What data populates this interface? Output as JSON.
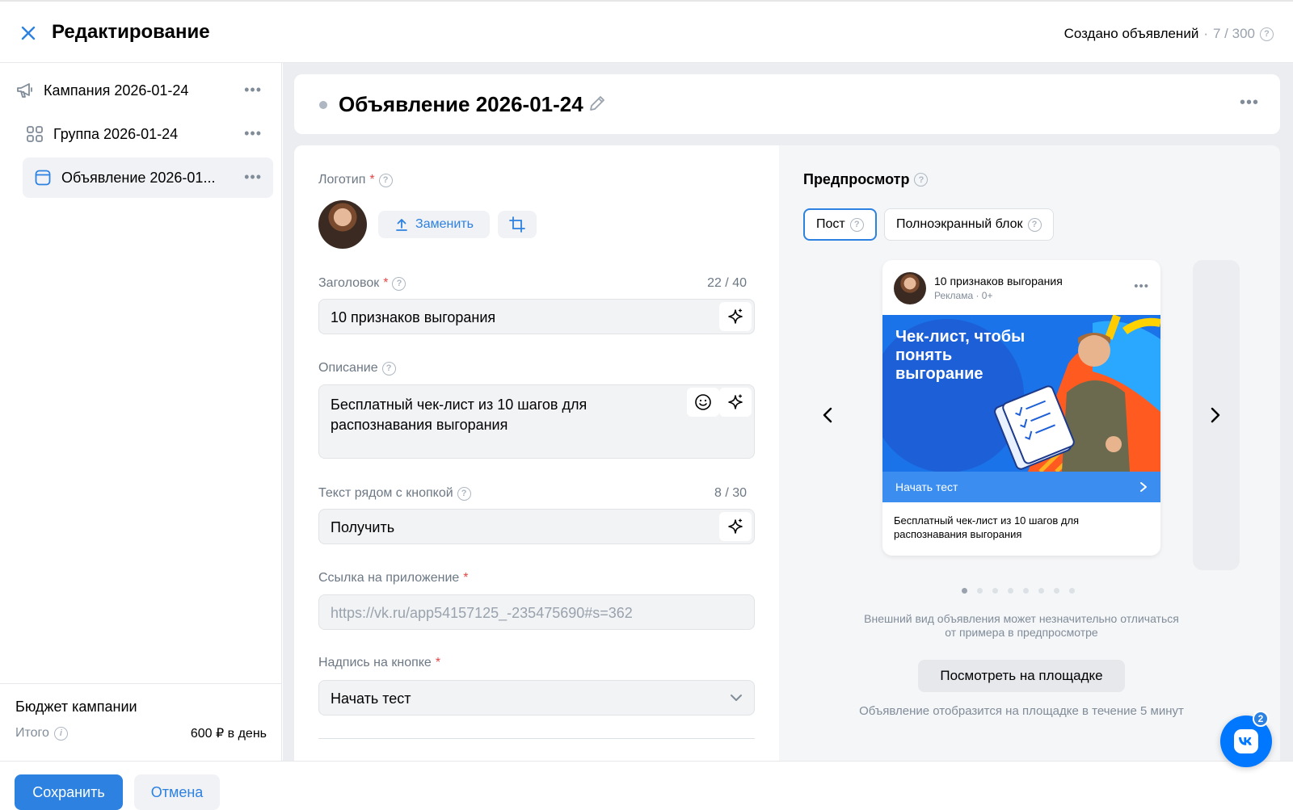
{
  "header": {
    "title": "Редактирование",
    "created_label": "Создано объявлений",
    "separator": "·",
    "created_count": "7 / 300"
  },
  "sidebar": {
    "items": [
      {
        "label": "Кампания 2026-01-24",
        "icon": "megaphone-icon"
      },
      {
        "label": "Группа 2026-01-24",
        "icon": "grid-icon"
      },
      {
        "label": "Объявление 2026-01...",
        "icon": "ad-icon"
      }
    ],
    "budget": {
      "title": "Бюджет кампании",
      "total_label": "Итого",
      "total_value": "600 ₽ в день"
    }
  },
  "ad": {
    "title": "Объявление 2026-01-24"
  },
  "form": {
    "logo": {
      "label": "Логотип",
      "replace_label": "Заменить"
    },
    "headline": {
      "label": "Заголовок",
      "counter": "22 / 40",
      "value": "10 признаков выгорания"
    },
    "description": {
      "label": "Описание",
      "value": "Бесплатный чек-лист из 10 шагов для распознавания выгорания"
    },
    "button_text": {
      "label": "Текст рядом с кнопкой",
      "counter": "8 / 30",
      "value": "Получить"
    },
    "app_link": {
      "label": "Ссылка на приложение",
      "value": "https://vk.ru/app54157125_-235475690#s=362"
    },
    "button_caption": {
      "label": "Надпись на кнопке",
      "value": "Начать тест"
    }
  },
  "preview": {
    "title": "Предпросмотр",
    "tabs": [
      {
        "label": "Пост",
        "active": true
      },
      {
        "label": "Полноэкранный блок",
        "active": false
      }
    ],
    "post": {
      "name": "10 признаков выгорания",
      "meta": "Реклама · 0+",
      "banner_text": "Чек-лист, чтобы понять выгорание",
      "cta": "Начать тест",
      "description": "Бесплатный чек-лист из 10 шагов для распознавания выгорания"
    },
    "dots_total": 8,
    "dots_active_index": 0,
    "note": "Внешний вид объявления может незначительно отличаться от примера в предпросмотре",
    "view_button": "Посмотреть на площадке",
    "display_note": "Объявление отобразится на площадке в течение 5 минут"
  },
  "footer": {
    "save": "Сохранить",
    "cancel": "Отмена"
  },
  "chat": {
    "badge": "2"
  },
  "colors": {
    "accent": "#2d81e0",
    "vk_blue": "#0077ff",
    "required": "#e64646"
  }
}
